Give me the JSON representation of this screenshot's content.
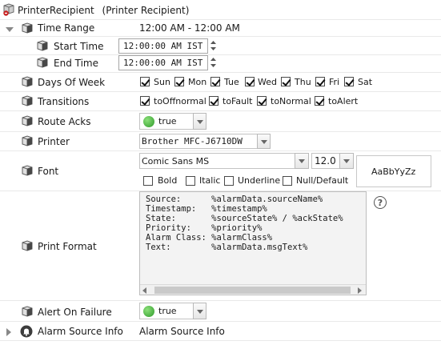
{
  "header": {
    "title": "PrinterRecipient",
    "subtitle": "(Printer Recipient)"
  },
  "time_range": {
    "label": "Time Range",
    "value": "12:00 AM - 12:00 AM"
  },
  "start_time": {
    "label": "Start Time",
    "value": "12:00:00 AM IST"
  },
  "end_time": {
    "label": "End Time",
    "value": "12:00:00 AM IST"
  },
  "days_of_week": {
    "label": "Days Of Week",
    "days": [
      {
        "label": "Sun",
        "checked": true
      },
      {
        "label": "Mon",
        "checked": true
      },
      {
        "label": "Tue",
        "checked": true
      },
      {
        "label": "Wed",
        "checked": true
      },
      {
        "label": "Thu",
        "checked": true
      },
      {
        "label": "Fri",
        "checked": true
      },
      {
        "label": "Sat",
        "checked": true
      }
    ]
  },
  "transitions": {
    "label": "Transitions",
    "items": [
      {
        "label": "toOffnormal",
        "checked": true
      },
      {
        "label": "toFault",
        "checked": true
      },
      {
        "label": "toNormal",
        "checked": true
      },
      {
        "label": "toAlert",
        "checked": true
      }
    ]
  },
  "route_acks": {
    "label": "Route Acks",
    "value": "true"
  },
  "printer": {
    "label": "Printer",
    "value": "Brother MFC-J6710DW"
  },
  "font": {
    "label": "Font",
    "family": "Comic Sans MS",
    "size": "12.0",
    "options": [
      {
        "label": "Bold",
        "checked": false
      },
      {
        "label": "Italic",
        "checked": false
      },
      {
        "label": "Underline",
        "checked": false
      },
      {
        "label": "Null/Default",
        "checked": false
      }
    ],
    "preview": "AaBbYyZz"
  },
  "print_format": {
    "label": "Print Format",
    "lines": [
      "Source:      %alarmData.sourceName%",
      "Timestamp:   %timestamp%",
      "State:       %sourceState% / %ackState%",
      "Priority:    %priority%",
      "Alarm Class: %alarmClass%",
      "Text:        %alarmData.msgText%"
    ],
    "help_glyph": "?"
  },
  "alert_on_failure": {
    "label": "Alert On Failure",
    "value": "true"
  },
  "alarm_source_info": {
    "label": "Alarm Source Info",
    "value": "Alarm Source Info"
  },
  "icons": {
    "row": "cube-icon",
    "header": "printer-recipient-icon",
    "alarm": "alarm-icon"
  }
}
